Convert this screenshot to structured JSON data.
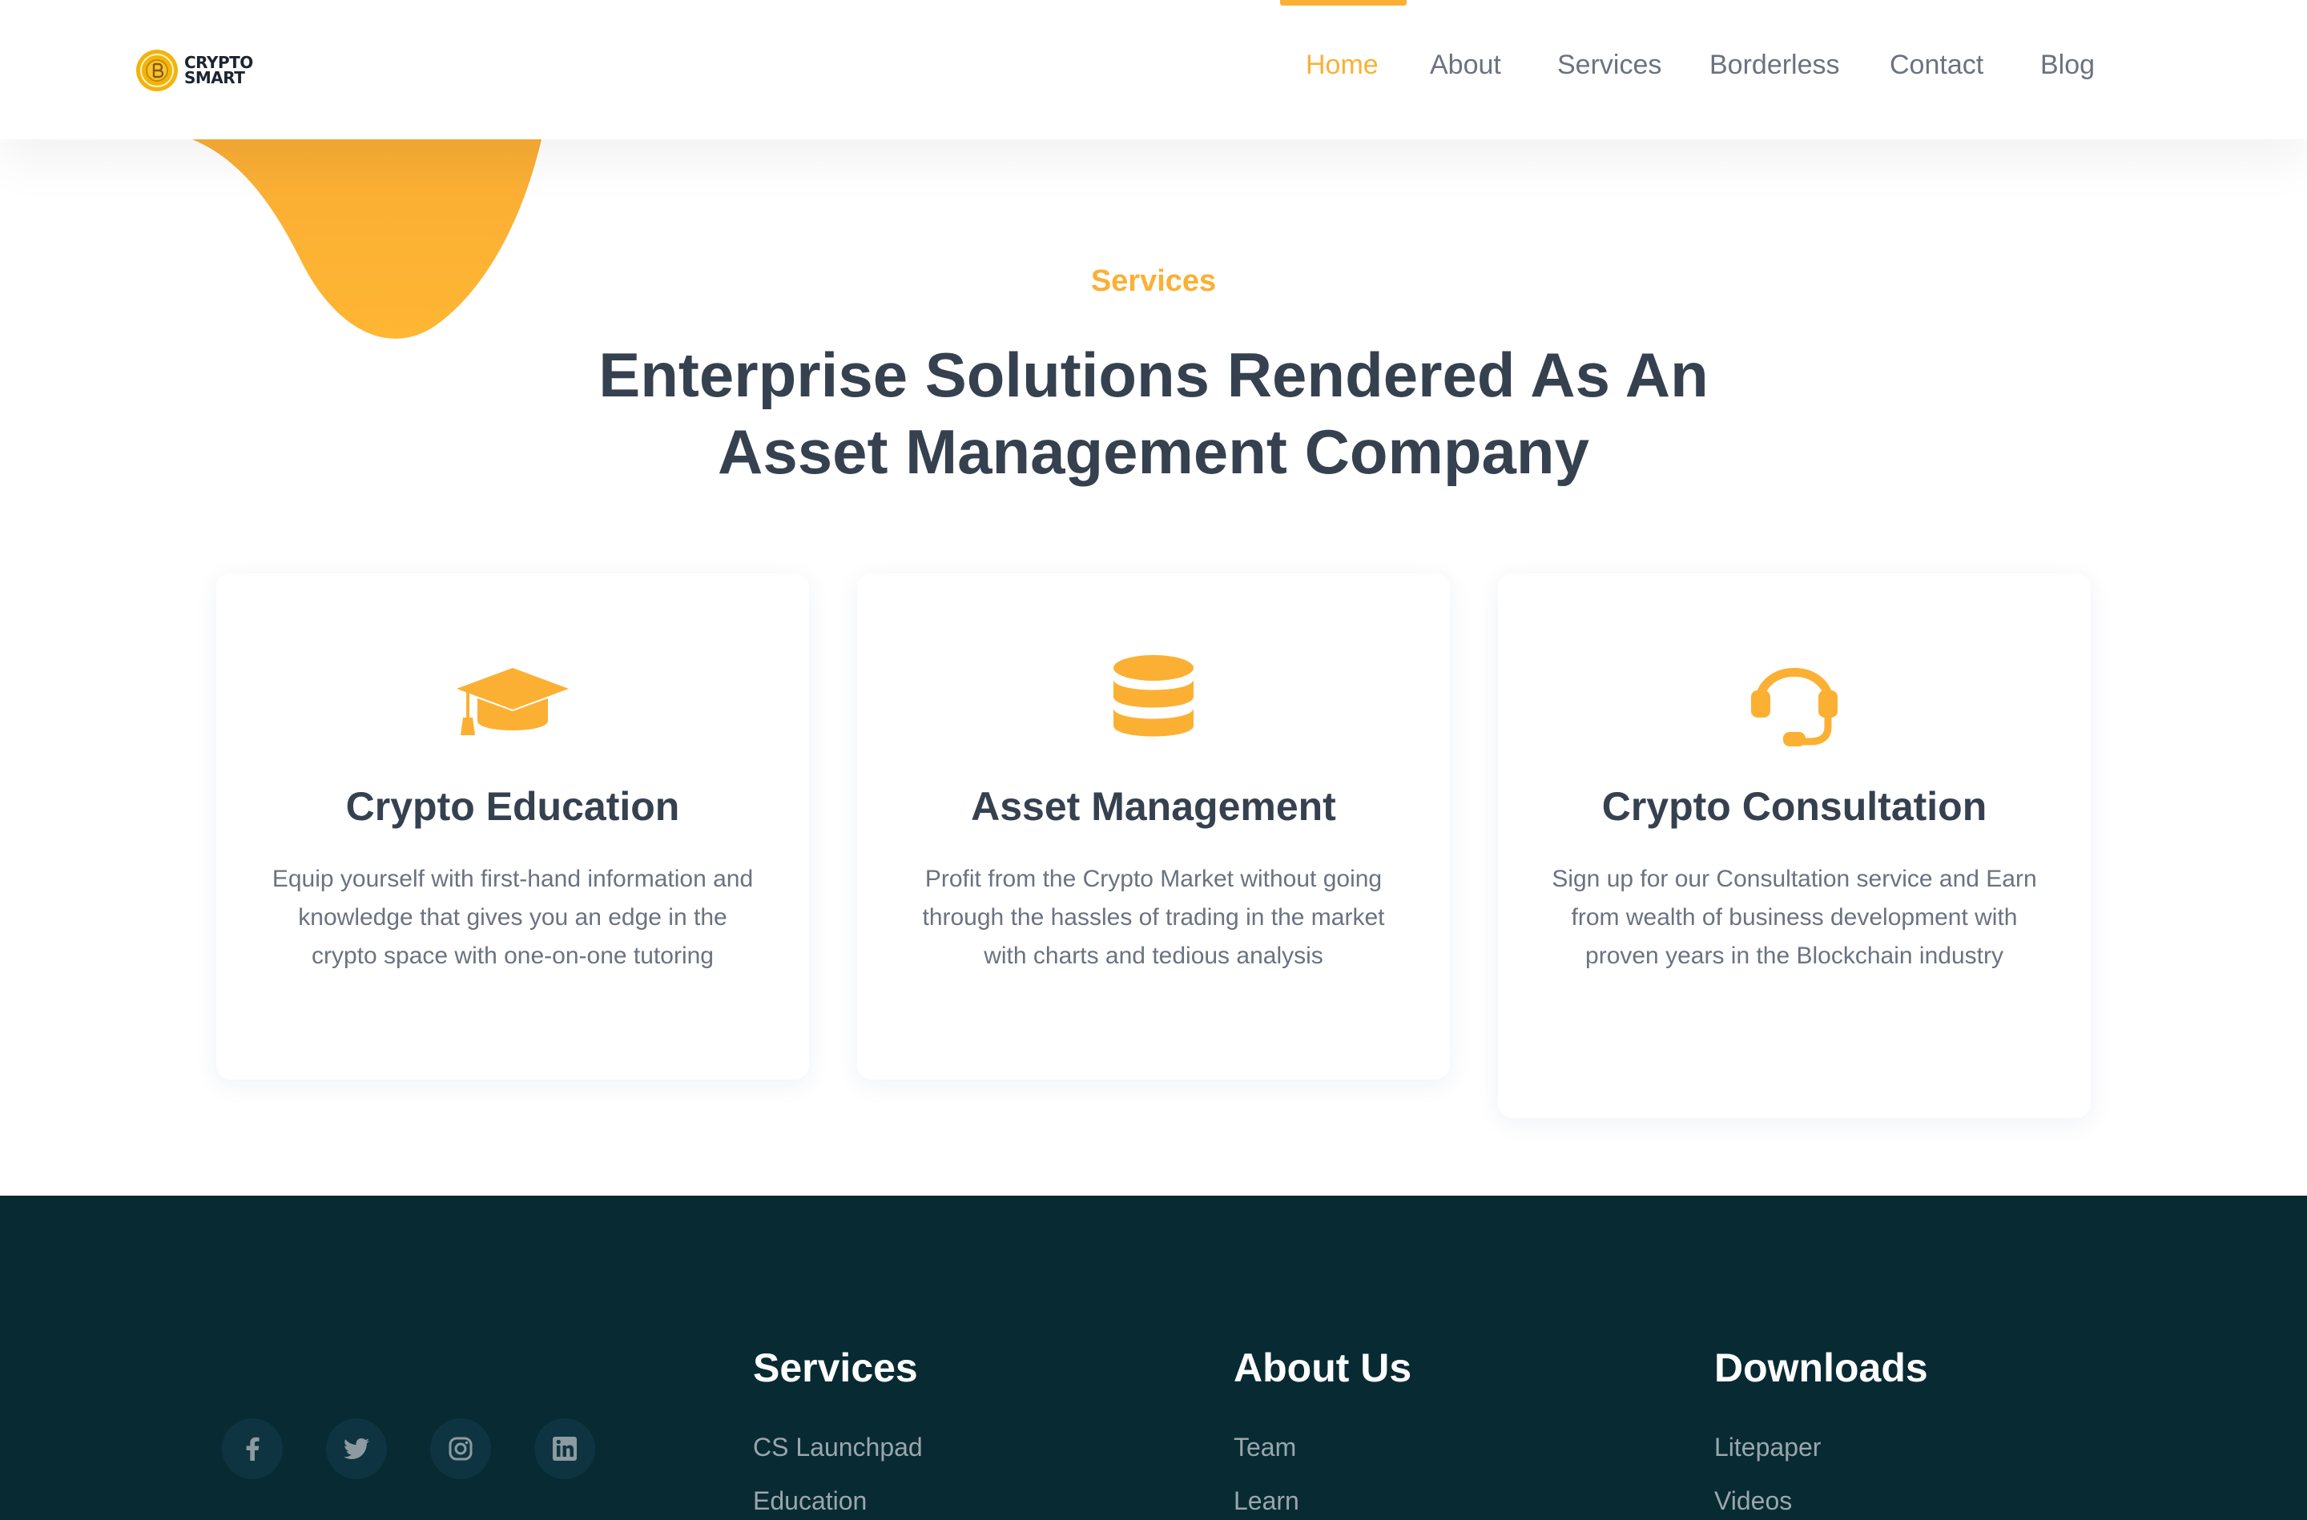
{
  "brand": {
    "logo_text_line1": "CRYPTO",
    "logo_text_line2": "SMART",
    "accent_color": "#fbb034",
    "dark_color": "#364150",
    "footer_bg": "#082a33"
  },
  "nav": {
    "items": [
      {
        "label": "Home",
        "active": true
      },
      {
        "label": "About"
      },
      {
        "label": "Services"
      },
      {
        "label": "Borderless"
      },
      {
        "label": "Contact"
      },
      {
        "label": "Blog"
      }
    ]
  },
  "services": {
    "eyebrow": "Services",
    "title_line1": "Enterprise Solutions Rendered As An",
    "title_line2": "Asset Management Company",
    "cards": [
      {
        "icon": "graduation-cap-icon",
        "title": "Crypto Education",
        "text": "Equip yourself with first-hand information and knowledge that gives you an edge in the crypto space with one-on-one tutoring"
      },
      {
        "icon": "database-icon",
        "title": "Asset Management",
        "text": "Profit from the Crypto Market without going through the hassles of trading in the market with charts and tedious analysis"
      },
      {
        "icon": "headset-icon",
        "title": "Crypto Consultation",
        "text": "Sign up for our Consultation service and Earn from wealth of business development with proven years in the Blockchain industry"
      }
    ]
  },
  "footer": {
    "social": [
      "facebook-icon",
      "twitter-icon",
      "instagram-icon",
      "linkedin-icon"
    ],
    "columns": [
      {
        "heading": "Services",
        "links": [
          "CS Launchpad",
          "Education"
        ]
      },
      {
        "heading": "About Us",
        "links": [
          "Team",
          "Learn"
        ]
      },
      {
        "heading": "Downloads",
        "links": [
          "Litepaper",
          "Videos"
        ]
      }
    ]
  }
}
